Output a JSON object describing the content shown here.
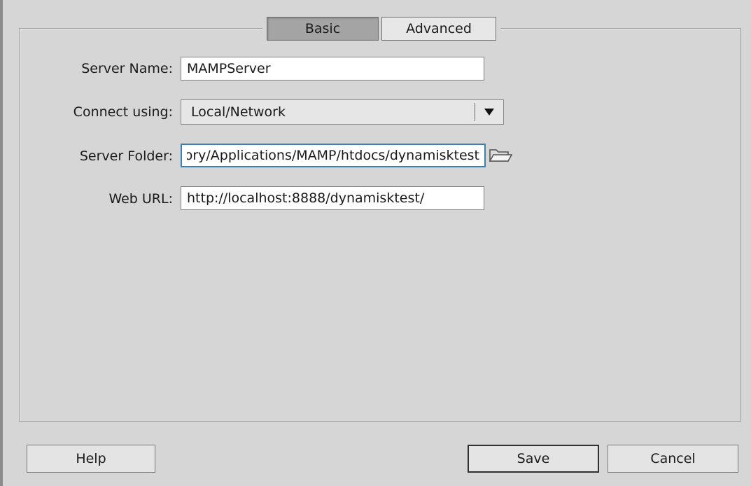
{
  "tabs": {
    "basic_label": "Basic",
    "advanced_label": "Advanced"
  },
  "form": {
    "server_name": {
      "label": "Server Name:",
      "value": "MAMPServer"
    },
    "connect_using": {
      "label": "Connect using:",
      "value": "Local/Network"
    },
    "server_folder": {
      "label": "Server Folder:",
      "value": "ory/Applications/MAMP/htdocs/dynamisktest"
    },
    "web_url": {
      "label": "Web URL:",
      "value": "http://localhost:8888/dynamisktest/"
    }
  },
  "buttons": {
    "help_label": "Help",
    "save_label": "Save",
    "cancel_label": "Cancel"
  },
  "icons": {
    "dropdown": "chevron-down-icon",
    "browse_folder": "folder-icon"
  },
  "colors": {
    "background": "#d6d6d6",
    "active_tab": "#a4a4a4",
    "focus_border": "#3c7fb1"
  }
}
